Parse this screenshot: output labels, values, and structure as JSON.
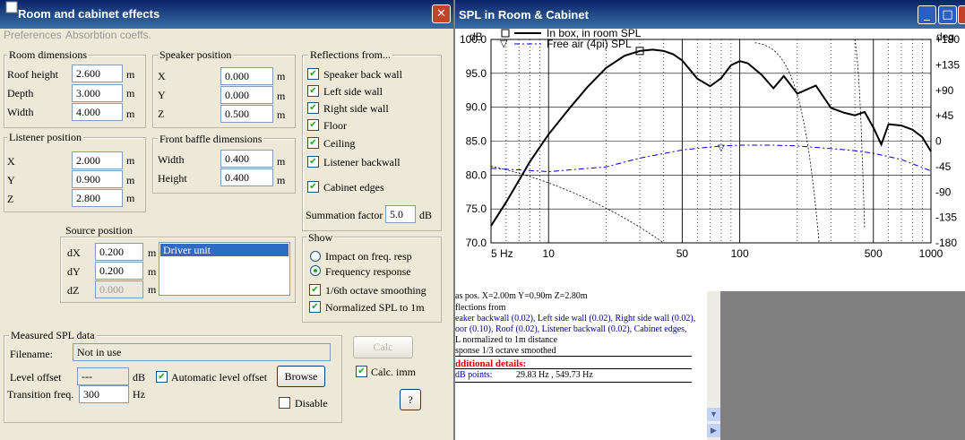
{
  "dialog": {
    "title": "Room and cabinet effects",
    "menu": {
      "preferences": "Preferences",
      "absorption": "Absorbtion coeffs."
    },
    "room": {
      "title": "Room dimensions",
      "roof_label": "Roof height",
      "roof": "2.600",
      "depth_label": "Depth",
      "depth": "3.000",
      "width_label": "Width",
      "width": "4.000",
      "unit": "m"
    },
    "listener": {
      "title": "Listener position",
      "x_label": "X",
      "x": "2.000",
      "y_label": "Y",
      "y": "0.900",
      "z_label": "Z",
      "z": "2.800"
    },
    "speaker": {
      "title": "Speaker position",
      "x_label": "X",
      "x": "0.000",
      "y_label": "Y",
      "y": "0.000",
      "z_label": "Z",
      "z": "0.500"
    },
    "baffle": {
      "title": "Front baffle dimensions",
      "width_label": "Width",
      "width": "0.400",
      "height_label": "Height",
      "height": "0.400"
    },
    "reflections": {
      "title": "Reflections from...",
      "items": [
        "Speaker back wall",
        "Left side wall",
        "Right side wall",
        "Floor",
        "Ceiling",
        "Listener backwall"
      ],
      "cabinet_edges": "Cabinet edges",
      "summation_label": "Summation factor",
      "summation": "5.0",
      "summation_unit": "dB"
    },
    "source": {
      "title": "Source position",
      "dx_label": "dX",
      "dx": "0.200",
      "dy_label": "dY",
      "dy": "0.200",
      "dz_label": "dZ",
      "dz": "0.000",
      "list_item": "Driver unit"
    },
    "show": {
      "title": "Show",
      "impact": "Impact on freq. resp",
      "freq": "Frequency response",
      "smoothing": "1/6th octave smoothing",
      "normalized": "Normalized SPL to 1m"
    },
    "measured": {
      "title": "Measured SPL data",
      "filename_label": "Filename:",
      "filename": "Not in use",
      "level_label": "Level offset",
      "level": "---",
      "level_unit": "dB",
      "auto": "Automatic level offset",
      "browse": "Browse",
      "transition_label": "Transition freq.",
      "transition": "300",
      "transition_unit": "Hz",
      "disable": "Disable"
    },
    "calc": "Calc",
    "calc_imm": "Calc. imm",
    "help": "?"
  },
  "spl_window": {
    "title": "SPL in Room & Cabinet",
    "colors": {
      "title_bar": "#0a246a",
      "main_curve": "#000000",
      "free_air": "#0000cc"
    }
  },
  "report": {
    "lines": [
      "as pos.        X=2.00m        Y=0.90m       Z=2.80m",
      "flections from",
      "eaker backwall (0.02), Left side wall (0.02), Right side wall (0.02),",
      "oor (0.10), Roof (0.02), Listener backwall (0.02), Cabinet edges,",
      "L normalized to 1m distance",
      "sponse 1/3 octave smoothed"
    ],
    "additional": "dditional details:",
    "points_label": "dB points:",
    "points": "29.83 Hz  ,  549.73 Hz"
  },
  "chart_data": {
    "type": "line",
    "title": "",
    "ylabel_left": "dB",
    "ylabel_right": "deg",
    "x_scale": "log",
    "xlim": [
      5,
      1000
    ],
    "x_ticks": [
      "5 Hz",
      "10",
      "50",
      "100",
      "500",
      "1000"
    ],
    "ylim": [
      70,
      100
    ],
    "y_ticks": [
      "100.0",
      "95.0",
      "90.0",
      "85.0",
      "80.0",
      "75.0",
      "70.0"
    ],
    "y2lim": [
      -180,
      180
    ],
    "y2_ticks": [
      "+180",
      "+135",
      "+90",
      "+45",
      "0",
      "-45",
      "-90",
      "-135",
      "-180"
    ],
    "grid": true,
    "legend_position": "top-left",
    "series": [
      {
        "name": "In box, in room SPL",
        "marker": "□",
        "x": [
          5,
          6,
          7,
          8,
          10,
          13,
          16,
          20,
          25,
          30,
          35,
          40,
          45,
          50,
          55,
          60,
          70,
          80,
          90,
          100,
          110,
          130,
          150,
          170,
          200,
          250,
          300,
          350,
          400,
          450,
          500,
          550,
          600,
          700,
          800,
          900,
          1000
        ],
        "y": [
          72.5,
          76,
          79.2,
          82,
          86,
          90,
          93,
          95.8,
          97.6,
          98.3,
          98.5,
          98.3,
          97.8,
          96.9,
          95.5,
          94.2,
          93.1,
          94.3,
          96.2,
          96.8,
          96.5,
          94.8,
          92.8,
          94.6,
          92,
          93.2,
          89.9,
          89.2,
          88.8,
          89.3,
          87,
          84.5,
          87.5,
          87.3,
          86.7,
          85.6,
          83.5
        ]
      },
      {
        "name": "Free air (4pi) SPL",
        "marker": "▽",
        "x": [
          5,
          10,
          20,
          30,
          50,
          80,
          100,
          150,
          200,
          300,
          400,
          500,
          700,
          1000
        ],
        "y": [
          81,
          80.5,
          81.2,
          82.5,
          83.7,
          84.3,
          84.4,
          84.4,
          84.3,
          83.9,
          83.6,
          83.2,
          82.3,
          80.6
        ]
      }
    ]
  }
}
